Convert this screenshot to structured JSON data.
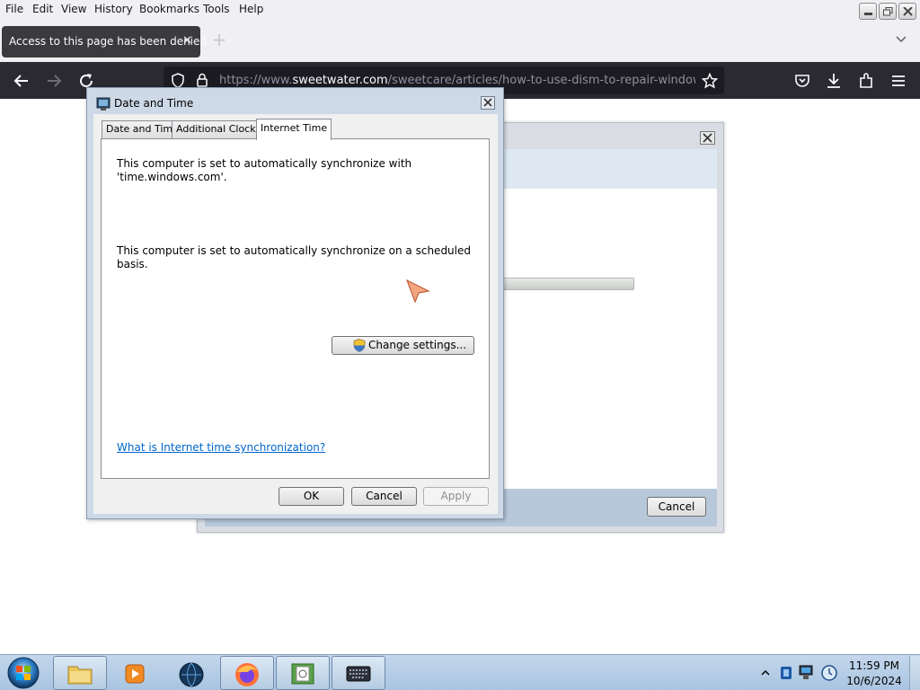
{
  "browser": {
    "menu": [
      "File",
      "Edit",
      "View",
      "History",
      "Bookmarks",
      "Tools",
      "Help"
    ],
    "tab": {
      "title": "Access to this page has been denied",
      "close_glyph": "✕"
    },
    "new_tab_glyph": "+",
    "url": {
      "prefix": "https://www.",
      "domain": "sweetwater.com",
      "path": "/sweetcare/articles/how-to-use-dism-to-repair-windows-..."
    }
  },
  "background_dialog": {
    "cancel_label": "Cancel"
  },
  "date_time_dialog": {
    "title": "Date and Time",
    "tabs": [
      "Date and Time",
      "Additional Clocks",
      "Internet Time"
    ],
    "active_tab": "Internet Time",
    "sync_server_line1": "This computer is set to automatically synchronize with",
    "sync_server_line2": "'time.windows.com'.",
    "sync_schedule": "This computer is set to automatically synchronize on a scheduled basis.",
    "change_settings_label": "Change settings...",
    "help_link": "What is Internet time synchronization?",
    "ok_label": "OK",
    "cancel_label": "Cancel",
    "apply_label": "Apply"
  },
  "taskbar": {
    "apps": [
      "file-explorer",
      "media-player",
      "globe-app",
      "firefox",
      "notepad-app",
      "keyboard-app"
    ],
    "clock_time": "11:59 PM",
    "clock_date": "10/6/2024"
  },
  "colors": {
    "nav_dark": "#2b2a33",
    "link_blue": "#0066cc",
    "taskbar": "#b4cbe2"
  }
}
